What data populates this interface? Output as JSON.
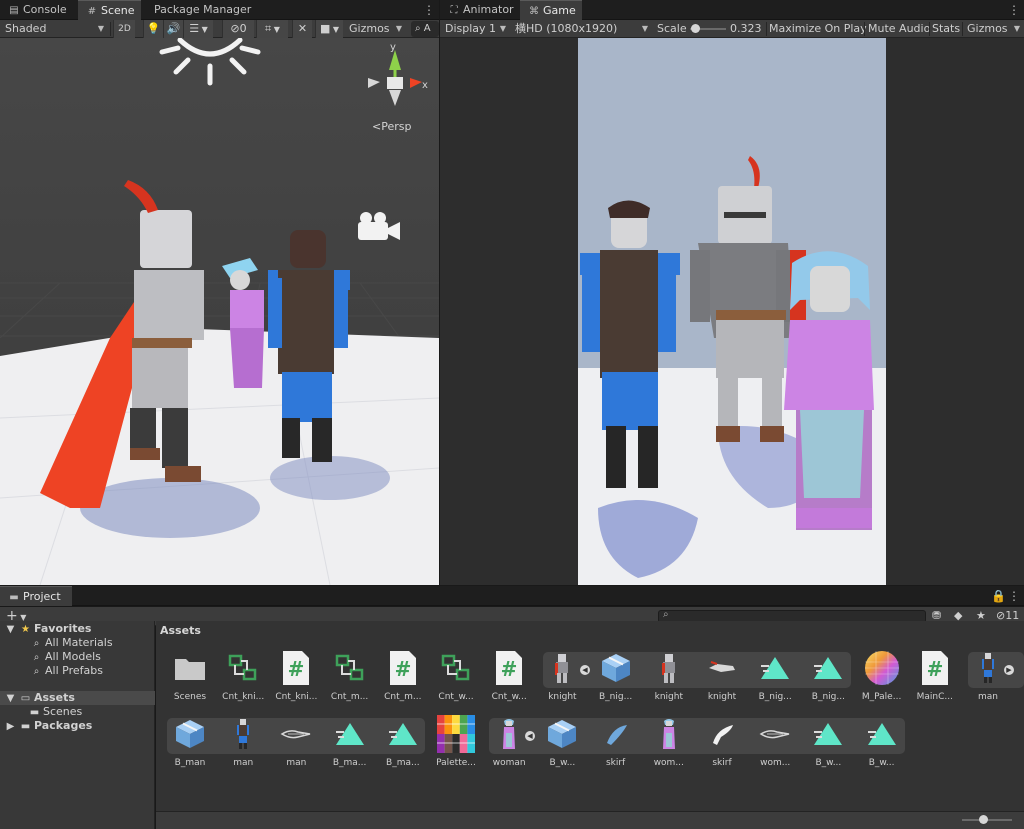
{
  "scene_window": {
    "tabs": [
      {
        "label": "Console",
        "icon": "console-icon"
      },
      {
        "label": "Scene",
        "icon": "scene-grid-icon"
      },
      {
        "label": "Package Manager",
        "icon": "package-icon"
      }
    ],
    "active_tab": "Scene",
    "toolbar": {
      "shading_mode": "Shaded",
      "mode_2d": "2D",
      "hidden_count": "0",
      "gizmos": "Gizmos",
      "search_fragment": "A"
    },
    "axis_labels": {
      "y": "y",
      "x": "x"
    },
    "projection_label": "<Persp"
  },
  "game_window": {
    "tabs": [
      {
        "label": "Animator",
        "icon": "animator-icon"
      },
      {
        "label": "Game",
        "icon": "gamepad-icon"
      }
    ],
    "active_tab": "Game",
    "toolbar": {
      "display": "Display 1",
      "resolution": "横HD (1080x1920)",
      "scale_label": "Scale",
      "scale_value": "0.323",
      "scale_fraction": 0.05,
      "maximize_on_play": "Maximize On Play",
      "mute_audio": "Mute Audio",
      "stats": "Stats",
      "gizmos": "Gizmos"
    }
  },
  "project_window": {
    "tab_label": "Project",
    "add_button": "+",
    "hidden_count": "11",
    "tree": {
      "favorites_label": "Favorites",
      "favorites": [
        "All Materials",
        "All Models",
        "All Prefabs"
      ],
      "assets_label": "Assets",
      "assets_children": [
        "Scenes"
      ],
      "packages_label": "Packages"
    },
    "breadcrumb": "Assets",
    "row1": [
      {
        "label": "Scenes",
        "icon": "folder"
      },
      {
        "label": "Cnt_kni...",
        "icon": "animator-controller"
      },
      {
        "label": "Cnt_kni...",
        "icon": "script"
      },
      {
        "label": "Cnt_m...",
        "icon": "animator-controller"
      },
      {
        "label": "Cnt_m...",
        "icon": "script"
      },
      {
        "label": "Cnt_w...",
        "icon": "animator-controller"
      },
      {
        "label": "Cnt_w...",
        "icon": "script"
      },
      {
        "label": "knight",
        "icon": "knight-prefab"
      },
      {
        "label": "B_nig...",
        "icon": "prefab-box"
      },
      {
        "label": "knight",
        "icon": "knight-model"
      },
      {
        "label": "knight",
        "icon": "knight-cape"
      },
      {
        "label": "B_nig...",
        "icon": "avatar-mask"
      },
      {
        "label": "B_nig...",
        "icon": "avatar-mask"
      },
      {
        "label": "M_Pale...",
        "icon": "material-ball"
      },
      {
        "label": "MainC...",
        "icon": "script"
      },
      {
        "label": "man",
        "icon": "man-prefab"
      }
    ],
    "row2": [
      {
        "label": "B_man",
        "icon": "prefab-box"
      },
      {
        "label": "man",
        "icon": "man-model"
      },
      {
        "label": "man",
        "icon": "man-wire"
      },
      {
        "label": "B_ma...",
        "icon": "avatar-mask"
      },
      {
        "label": "B_ma...",
        "icon": "avatar-mask"
      },
      {
        "label": "Palette...",
        "icon": "palette-texture"
      },
      {
        "label": "woman",
        "icon": "woman-prefab"
      },
      {
        "label": "B_w...",
        "icon": "prefab-box"
      },
      {
        "label": "skirf",
        "icon": "skirf-blue"
      },
      {
        "label": "wom...",
        "icon": "woman-model"
      },
      {
        "label": "skirf",
        "icon": "skirf-white"
      },
      {
        "label": "wom...",
        "icon": "woman-wire"
      },
      {
        "label": "B_w...",
        "icon": "avatar-mask"
      },
      {
        "label": "B_w...",
        "icon": "avatar-mask"
      }
    ]
  },
  "colors": {
    "accent_green": "#3ea15a",
    "mask_cyan": "#5fe6c8",
    "prefab_blue": "#6fa8dc",
    "favorites_star": "#f2c94c",
    "cape_red": "#ee4324",
    "sky_game": "#a9b6c9"
  }
}
